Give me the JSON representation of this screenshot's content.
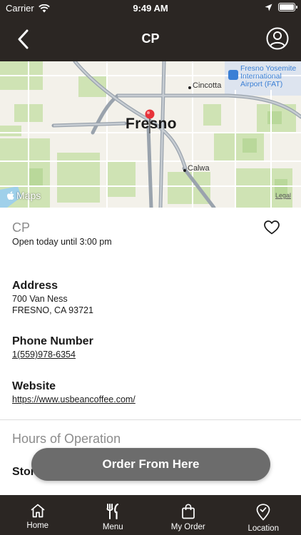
{
  "status_bar": {
    "carrier": "Carrier",
    "time": "9:49 AM"
  },
  "nav": {
    "title": "CP",
    "back_icon": "chevron-left-icon",
    "profile_icon": "user-circle-icon"
  },
  "map": {
    "city": "Fresno",
    "places": [
      "Cincotta",
      "Calwa"
    ],
    "airport": [
      "Fresno Yosemite",
      "International",
      "Airport (FAT)"
    ],
    "provider": "Maps",
    "legal": "Legal"
  },
  "store": {
    "name": "CP",
    "open_status": "Open today until 3:00 pm",
    "favorite_icon": "heart-outline-icon"
  },
  "address": {
    "title": "Address",
    "line1": "700 Van Ness",
    "line2": "FRESNO, CA 93721"
  },
  "phone": {
    "title": "Phone Number",
    "value": "1(559)978-6354"
  },
  "website": {
    "title": "Website",
    "value": "https://www.usbeancoffee.com/"
  },
  "hours": {
    "title": "Hours of Operation",
    "subtitle": "Stor"
  },
  "order_button": {
    "label": "Order From Here"
  },
  "tabs": [
    {
      "label": "Home",
      "icon": "home-icon"
    },
    {
      "label": "Menu",
      "icon": "fork-knife-icon"
    },
    {
      "label": "My Order",
      "icon": "shopping-bag-icon"
    },
    {
      "label": "Location",
      "icon": "location-pin-icon"
    }
  ],
  "colors": {
    "dark_bar": "#2b2623",
    "button_gray": "#6c6c6c",
    "muted_text": "#8c8c8c",
    "pin_red": "#e8333a"
  }
}
